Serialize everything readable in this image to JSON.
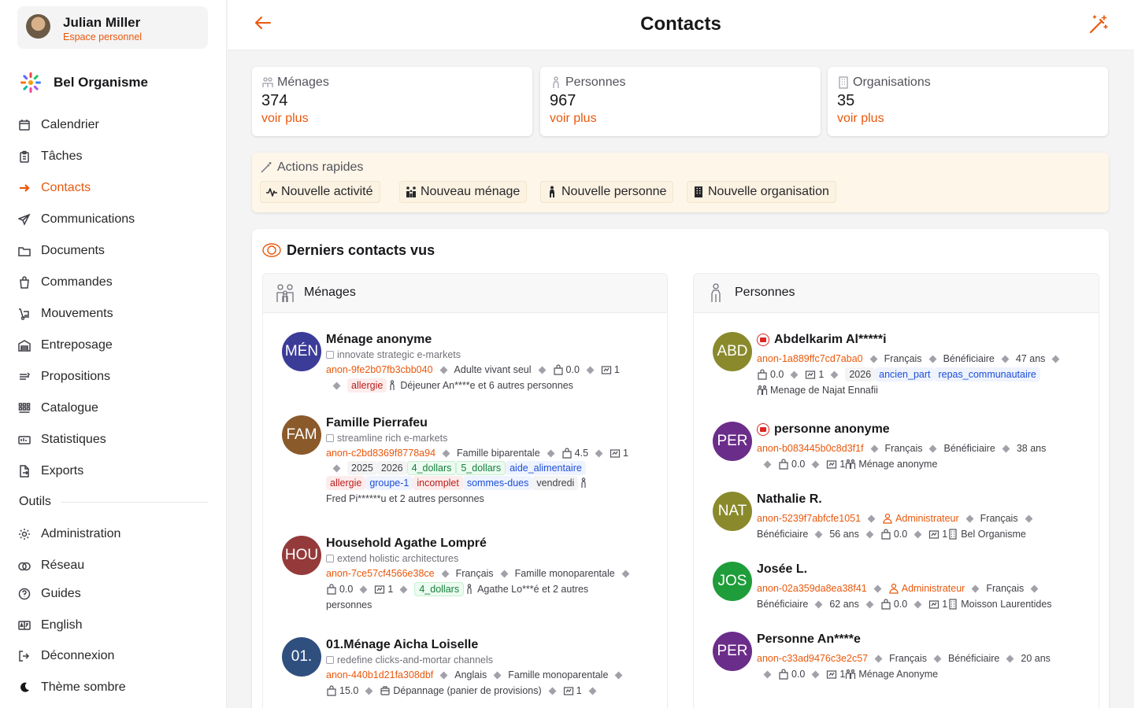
{
  "user": {
    "name": "Julian Miller",
    "subtitle": "Espace personnel"
  },
  "org": {
    "name": "Bel Organisme"
  },
  "nav": [
    {
      "label": "Calendrier",
      "icon": "calendar-icon"
    },
    {
      "label": "Tâches",
      "icon": "clipboard-icon"
    },
    {
      "label": "Contacts",
      "icon": "arrow-right-icon",
      "active": true
    },
    {
      "label": "Communications",
      "icon": "send-icon"
    },
    {
      "label": "Documents",
      "icon": "folder-icon"
    },
    {
      "label": "Commandes",
      "icon": "shopping-bag-icon"
    },
    {
      "label": "Mouvements",
      "icon": "dolly-icon"
    },
    {
      "label": "Entreposage",
      "icon": "warehouse-icon"
    },
    {
      "label": "Propositions",
      "icon": "proposal-icon"
    },
    {
      "label": "Catalogue",
      "icon": "grid-icon"
    },
    {
      "label": "Statistiques",
      "icon": "stats-icon"
    },
    {
      "label": "Exports",
      "icon": "export-icon"
    }
  ],
  "tools_label": "Outils",
  "tools": [
    {
      "label": "Administration",
      "icon": "gear-icon"
    },
    {
      "label": "Réseau",
      "icon": "network-icon"
    },
    {
      "label": "Guides",
      "icon": "help-icon"
    },
    {
      "label": "English",
      "icon": "language-icon"
    },
    {
      "label": "Déconnexion",
      "icon": "logout-icon"
    },
    {
      "label": "Thème sombre",
      "icon": "moon-icon"
    }
  ],
  "header": {
    "title": "Contacts"
  },
  "stats": [
    {
      "title": "Ménages",
      "value": "374",
      "link": "voir plus"
    },
    {
      "title": "Personnes",
      "value": "967",
      "link": "voir plus"
    },
    {
      "title": "Organisations",
      "value": "35",
      "link": "voir plus"
    }
  ],
  "quick": {
    "title": "Actions rapides",
    "actions": [
      "Nouvelle activité",
      "Nouveau ménage",
      "Nouvelle personne",
      "Nouvelle organisation"
    ]
  },
  "recent": {
    "title": "Derniers contacts vus",
    "households_title": "Ménages",
    "persons_title": "Personnes",
    "households": [
      {
        "initials": "MÉN",
        "color": "#3b3b98",
        "name": "Ménage anonyme",
        "sub": "innovate strategic e-markets",
        "rows": [
          [
            {
              "t": "anon",
              "v": "anon-9fe2b07fb3cbb040"
            },
            {
              "t": "d"
            },
            {
              "t": "x",
              "v": "Adulte vivant seul"
            },
            {
              "t": "d"
            },
            {
              "t": "bag",
              "v": "0.0"
            },
            {
              "t": "d"
            },
            {
              "t": "inv",
              "v": "1"
            }
          ],
          [
            {
              "t": "d"
            },
            {
              "t": "red",
              "v": "allergie"
            },
            {
              "t": "per",
              "v": "Déjeuner An****e et 6 autres personnes"
            }
          ]
        ]
      },
      {
        "initials": "FAM",
        "color": "#8b5a2b",
        "name": "Famille Pierrafeu",
        "sub": "streamline rich e-markets",
        "rows": [
          [
            {
              "t": "anon",
              "v": "anon-c2bd8369f8778a94"
            },
            {
              "t": "d"
            },
            {
              "t": "x",
              "v": "Famille biparentale"
            },
            {
              "t": "d"
            },
            {
              "t": "bag",
              "v": "4.5"
            },
            {
              "t": "d"
            },
            {
              "t": "inv",
              "v": "1"
            }
          ],
          [
            {
              "t": "d"
            },
            {
              "t": "gray",
              "v": "2025"
            },
            {
              "t": "gray",
              "v": "2026"
            },
            {
              "t": "green",
              "v": "4_dollars"
            },
            {
              "t": "green",
              "v": "5_dollars"
            },
            {
              "t": "blue",
              "v": "aide_alimentaire"
            }
          ],
          [
            {
              "t": "red",
              "v": "allergie"
            },
            {
              "t": "blue",
              "v": "groupe-1"
            },
            {
              "t": "red",
              "v": "incomplet"
            },
            {
              "t": "blue",
              "v": "sommes-dues"
            },
            {
              "t": "gray",
              "v": "vendredi"
            },
            {
              "t": "per",
              "v": ""
            }
          ],
          [
            {
              "t": "x",
              "v": "Fred Pi******u et 2 autres personnes"
            }
          ]
        ]
      },
      {
        "initials": "HOU",
        "color": "#943a3a",
        "name": "Household Agathe Lompré",
        "sub": "extend holistic architectures",
        "rows": [
          [
            {
              "t": "anon",
              "v": "anon-7ce57cf4566e38ce"
            },
            {
              "t": "d"
            },
            {
              "t": "x",
              "v": "Français"
            },
            {
              "t": "d"
            },
            {
              "t": "x",
              "v": "Famille monoparentale"
            },
            {
              "t": "d"
            }
          ],
          [
            {
              "t": "bag",
              "v": "0.0"
            },
            {
              "t": "d"
            },
            {
              "t": "inv",
              "v": "1"
            },
            {
              "t": "d"
            },
            {
              "t": "green",
              "v": "4_dollars"
            },
            {
              "t": "per",
              "v": "Agathe Lo***é et 2 autres"
            }
          ],
          [
            {
              "t": "x",
              "v": "personnes"
            }
          ]
        ]
      },
      {
        "initials": "01.",
        "color": "#2f4f7f",
        "name": "01.Ménage Aicha Loiselle",
        "sub": "redefine clicks-and-mortar channels",
        "rows": [
          [
            {
              "t": "anon",
              "v": "anon-440b1d21fa308dbf"
            },
            {
              "t": "d"
            },
            {
              "t": "x",
              "v": "Anglais"
            },
            {
              "t": "d"
            },
            {
              "t": "x",
              "v": "Famille monoparentale"
            },
            {
              "t": "d"
            }
          ],
          [
            {
              "t": "bag",
              "v": "15.0"
            },
            {
              "t": "d"
            },
            {
              "t": "box",
              "v": "Dépannage (panier de provisions)"
            },
            {
              "t": "d"
            },
            {
              "t": "inv",
              "v": "1"
            },
            {
              "t": "d"
            }
          ]
        ]
      }
    ],
    "persons": [
      {
        "initials": "ABD",
        "color": "#8a8a2c",
        "name": "Abdelkarim Al*****i",
        "flag": true,
        "rows": [
          [
            {
              "t": "anon",
              "v": "anon-1a889ffc7cd7aba0"
            },
            {
              "t": "d"
            },
            {
              "t": "x",
              "v": "Français"
            },
            {
              "t": "d"
            },
            {
              "t": "x",
              "v": "Bénéficiaire"
            },
            {
              "t": "d"
            },
            {
              "t": "x",
              "v": "47 ans"
            },
            {
              "t": "d"
            }
          ],
          [
            {
              "t": "bag",
              "v": "0.0"
            },
            {
              "t": "d"
            },
            {
              "t": "inv",
              "v": "1"
            },
            {
              "t": "d"
            },
            {
              "t": "gray",
              "v": "2026"
            },
            {
              "t": "blue",
              "v": "ancien_part"
            },
            {
              "t": "blue",
              "v": "repas_communautaire"
            }
          ],
          [
            {
              "t": "hh",
              "v": "Menage de Najat Ennafii"
            }
          ]
        ]
      },
      {
        "initials": "PER",
        "color": "#6b2d8a",
        "name": "personne anonyme",
        "flag": true,
        "rows": [
          [
            {
              "t": "anon",
              "v": "anon-b083445b0c8d3f1f"
            },
            {
              "t": "d"
            },
            {
              "t": "x",
              "v": "Français"
            },
            {
              "t": "d"
            },
            {
              "t": "x",
              "v": "Bénéficiaire"
            },
            {
              "t": "d"
            },
            {
              "t": "x",
              "v": "38 ans"
            }
          ],
          [
            {
              "t": "d"
            },
            {
              "t": "bag",
              "v": "0.0"
            },
            {
              "t": "d"
            },
            {
              "t": "inv",
              "v": "1"
            },
            {
              "t": "hh",
              "v": "Ménage anonyme"
            }
          ]
        ]
      },
      {
        "initials": "NAT",
        "color": "#8a8a2c",
        "name": "Nathalie R.",
        "rows": [
          [
            {
              "t": "anon",
              "v": "anon-5239f7abfcfe1051"
            },
            {
              "t": "d"
            },
            {
              "t": "role",
              "v": "Administrateur"
            },
            {
              "t": "d"
            },
            {
              "t": "x",
              "v": "Français"
            },
            {
              "t": "d"
            }
          ],
          [
            {
              "t": "x",
              "v": "Bénéficiaire"
            },
            {
              "t": "d"
            },
            {
              "t": "x",
              "v": "56 ans"
            },
            {
              "t": "d"
            },
            {
              "t": "bag",
              "v": "0.0"
            },
            {
              "t": "d"
            },
            {
              "t": "inv",
              "v": "1"
            },
            {
              "t": "org",
              "v": "Bel Organisme"
            }
          ]
        ]
      },
      {
        "initials": "JOS",
        "color": "#1f9d3a",
        "name": "Josée L.",
        "rows": [
          [
            {
              "t": "anon",
              "v": "anon-02a359da8ea38f41"
            },
            {
              "t": "d"
            },
            {
              "t": "role",
              "v": "Administrateur"
            },
            {
              "t": "d"
            },
            {
              "t": "x",
              "v": "Français"
            },
            {
              "t": "d"
            }
          ],
          [
            {
              "t": "x",
              "v": "Bénéficiaire"
            },
            {
              "t": "d"
            },
            {
              "t": "x",
              "v": "62 ans"
            },
            {
              "t": "d"
            },
            {
              "t": "bag",
              "v": "0.0"
            },
            {
              "t": "d"
            },
            {
              "t": "inv",
              "v": "1"
            },
            {
              "t": "org",
              "v": "Moisson Laurentides"
            }
          ]
        ]
      },
      {
        "initials": "PER",
        "color": "#6b2d8a",
        "name": "Personne An****e",
        "rows": [
          [
            {
              "t": "anon",
              "v": "anon-c33ad9476c3e2c57"
            },
            {
              "t": "d"
            },
            {
              "t": "x",
              "v": "Français"
            },
            {
              "t": "d"
            },
            {
              "t": "x",
              "v": "Bénéficiaire"
            },
            {
              "t": "d"
            },
            {
              "t": "x",
              "v": "20 ans"
            }
          ],
          [
            {
              "t": "d"
            },
            {
              "t": "bag",
              "v": "0.0"
            },
            {
              "t": "d"
            },
            {
              "t": "inv",
              "v": "1"
            },
            {
              "t": "hh",
              "v": "Ménage Anonyme"
            }
          ]
        ]
      }
    ]
  },
  "colors": {
    "accent": "#ea580c",
    "quick_bg": "#fdf6e9"
  }
}
